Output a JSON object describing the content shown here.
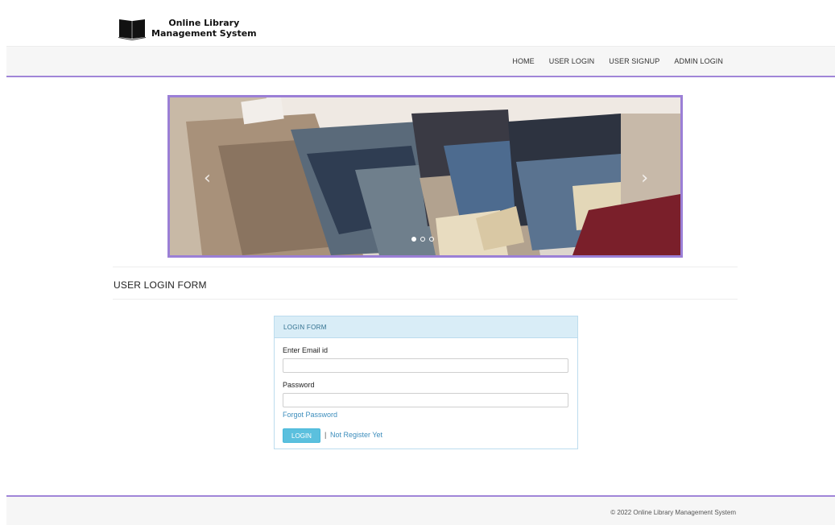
{
  "brand": {
    "line1": "Online Library",
    "line2": "Management System",
    "icon": "book-icon"
  },
  "nav": {
    "items": [
      {
        "label": "HOME"
      },
      {
        "label": "USER LOGIN"
      },
      {
        "label": "USER SIGNUP"
      },
      {
        "label": "ADMIN LOGIN"
      }
    ]
  },
  "carousel": {
    "prev_icon": "chevron-left-icon",
    "next_icon": "chevron-right-icon",
    "prev_glyph": "‹",
    "next_glyph": "›",
    "slide_count": 3,
    "active_slide": 1
  },
  "section": {
    "title": "USER LOGIN FORM"
  },
  "login_form": {
    "heading": "LOGIN FORM",
    "email_label": "Enter Email id",
    "email_value": "",
    "password_label": "Password",
    "password_value": "",
    "forgot_label": "Forgot Password",
    "login_label": "LOGIN",
    "separator": "|",
    "register_label": "Not Register Yet"
  },
  "footer": {
    "text": "© 2022 Online Library Management System"
  },
  "colors": {
    "accent": "#a085d8",
    "panel_heading_bg": "#d9edf7",
    "button_bg": "#5bc0de",
    "link": "#3c8dbc"
  }
}
